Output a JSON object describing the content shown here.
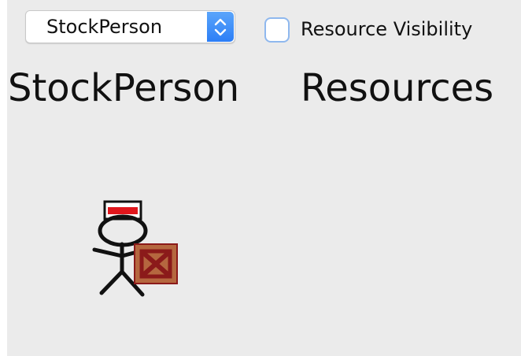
{
  "selector": {
    "value": "StockPerson"
  },
  "resource_visibility": {
    "label": "Resource Visibility",
    "checked": false
  },
  "headings": {
    "left": "StockPerson",
    "right": "Resources"
  },
  "icons": {
    "dropdown": "up-down-chevron-icon",
    "figure": "stock-person-figure",
    "box": "crate-icon"
  },
  "colors": {
    "accent": "#2c7ef6",
    "panel_bg": "#ebebeb",
    "cap_red": "#e0161c",
    "crate": "#b5673f",
    "crate_x": "#8b1a1a"
  }
}
